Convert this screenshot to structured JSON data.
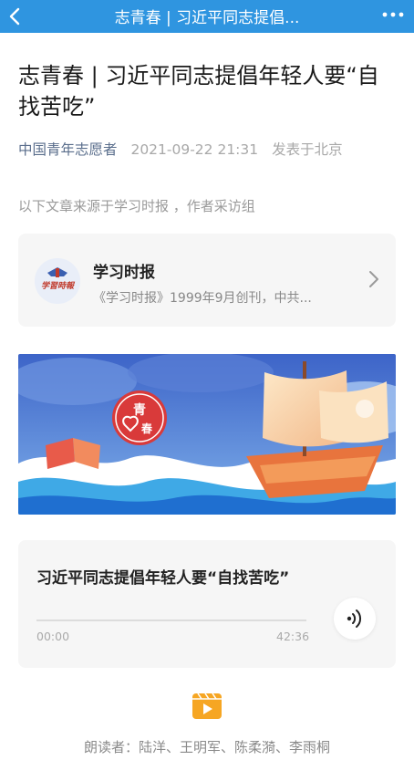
{
  "nav": {
    "title": "志青春 | 习近平同志提倡...",
    "back_icon": "chevron-left-icon",
    "more_icon": "more-dots-icon",
    "bar_color": "#2f95e0"
  },
  "article": {
    "headline": "志青春 | 习近平同志提倡年轻人要“自找苦吃”",
    "author": "中国青年志愿者",
    "time": "2021-09-22 21:31",
    "location": "发表于北京",
    "source_note": "以下文章来源于学习时报 ，作者采访组"
  },
  "account_card": {
    "name": "学习时报",
    "description": "《学习时报》1999年9月创刊，中共...",
    "avatar_icon": "newspaper-logo-icon",
    "avatar_logo_text": "学習時報"
  },
  "banner": {
    "logo_text": "志青春"
  },
  "audio": {
    "title": "习近平同志提倡年轻人要“自找苦吃”",
    "current_time": "00:00",
    "duration": "42:36",
    "progress": 0,
    "play_icon": "audio-wave-icon"
  },
  "video_icon": "video-clapper-icon",
  "readers": "朗读者：陆洋、王明军、陈柔漪、李雨桐",
  "colors": {
    "accent_blue": "#2f95e0",
    "author_link": "#5a6e8c",
    "video_orange": "#f6a623"
  }
}
